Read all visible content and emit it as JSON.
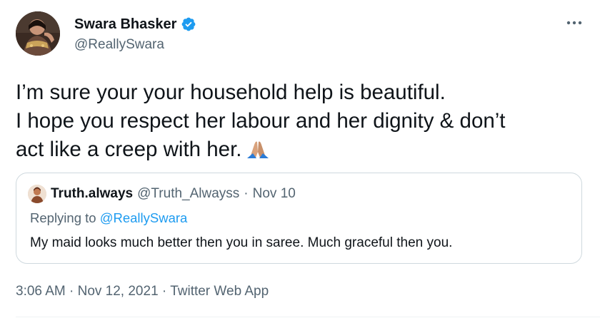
{
  "author": {
    "display_name": "Swara Bhasker",
    "handle": "@ReallySwara",
    "avatar_icon": "profile-photo",
    "verified_color": "#1d9bf0"
  },
  "tweet": {
    "lines": [
      "I’m sure your your household help is beautiful.",
      "I hope you respect her labour and her dignity & don’t",
      "act like a creep with her."
    ],
    "emoji": "folded-hands-icon"
  },
  "quote": {
    "name": "Truth.always",
    "handle": "@Truth_Alwayss",
    "separator": "·",
    "date": "Nov 10",
    "replying_prefix": "Replying to ",
    "replying_handle": "@ReallySwara",
    "text": "My maid looks much better then you in saree. Much graceful then you."
  },
  "meta": {
    "time": "3:06 AM",
    "sep1": " · ",
    "date": "Nov 12, 2021",
    "sep2": " · ",
    "source": "Twitter Web App"
  },
  "colors": {
    "text_primary": "#0f1419",
    "text_secondary": "#536471",
    "link": "#1d9bf0",
    "border": "#cfd9de"
  }
}
